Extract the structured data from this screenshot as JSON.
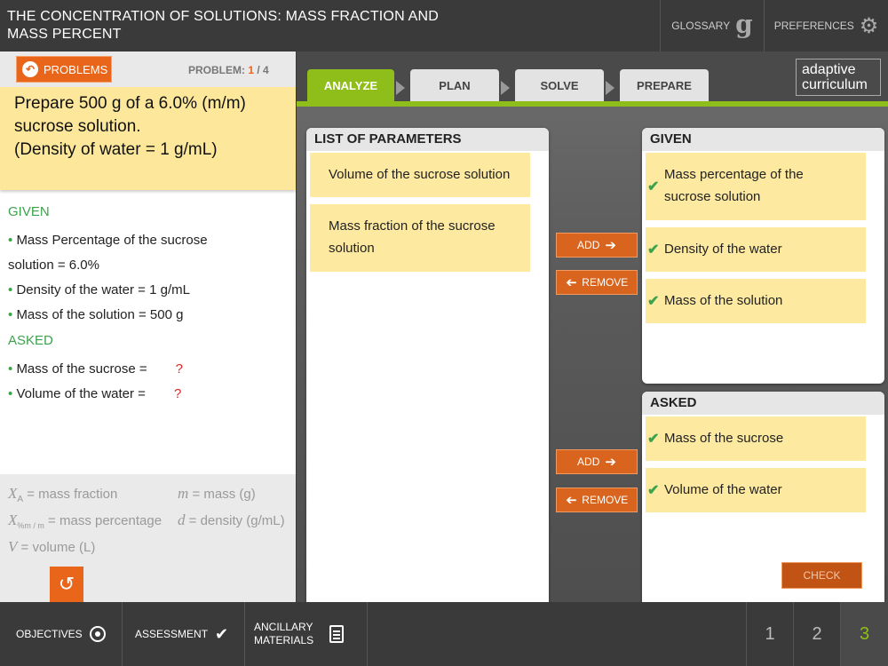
{
  "header": {
    "title": "THE CONCENTRATION OF SOLUTIONS: MASS FRACTION AND MASS PERCENT",
    "glossary_label": "GLOSSARY",
    "glossary_glyph": "g",
    "preferences_label": "PREFERENCES",
    "preferences_icon": "gear-icon"
  },
  "left": {
    "problems_label": "PROBLEMS",
    "problem_label": "PROBLEM:",
    "problem_current": "1",
    "problem_total": "/ 4",
    "prompt_lines": [
      "Prepare 500 g of a 6.0% (m/m)",
      "sucrose solution.",
      "(Density of water = 1 g/mL)"
    ],
    "given_heading": "GIVEN",
    "given_items": [
      "Mass Percentage of the sucrose",
      "solution = 6.0%",
      "Density of the water = 1 g/mL",
      "Mass of the solution = 500 g"
    ],
    "asked_heading": "ASKED",
    "asked_items": [
      "Mass of the sucrose =",
      "Volume of the water ="
    ],
    "asked_mark": "?",
    "legend": {
      "xa_symbol": "X",
      "xa_sub": "A",
      "xa_desc": " = mass fraction",
      "m_symbol": "m",
      "m_desc": " = mass (g)",
      "xp_symbol": "X",
      "xp_sub": "%m / m",
      "xp_desc": " = mass percentage",
      "d_symbol": "d",
      "d_desc": " = density (g/mL)",
      "v_symbol": "V",
      "v_desc": " = volume (L)"
    }
  },
  "tabs": [
    {
      "label": "ANALYZE",
      "active": true
    },
    {
      "label": "PLAN",
      "active": false
    },
    {
      "label": "SOLVE",
      "active": false
    },
    {
      "label": "PREPARE",
      "active": false
    }
  ],
  "logo": {
    "line1": "adaptive",
    "line2": "curriculum"
  },
  "parameters": {
    "heading": "LIST OF PARAMETERS",
    "items": [
      "Volume of the sucrose solution",
      "Mass fraction of the sucrose",
      "solution"
    ]
  },
  "given_panel": {
    "heading": "GIVEN",
    "items": [
      "Mass percentage of the",
      "sucrose solution",
      "Density of the water",
      "Mass of the solution"
    ]
  },
  "asked_panel": {
    "heading": "ASKED",
    "items": [
      "Mass of the sucrose",
      "Volume of the water"
    ]
  },
  "buttons": {
    "add": "ADD",
    "remove": "REMOVE",
    "check": "CHECK"
  },
  "footer": {
    "objectives": "OBJECTIVES",
    "assessment": "ASSESSMENT",
    "ancillary_1": "ANCILLARY",
    "ancillary_2": "MATERIALS",
    "pages": [
      "1",
      "2",
      "3"
    ],
    "current_page": "3"
  },
  "colors": {
    "accent": "#8fbe1a",
    "orange": "#e8651a",
    "note": "#fde9a0"
  }
}
